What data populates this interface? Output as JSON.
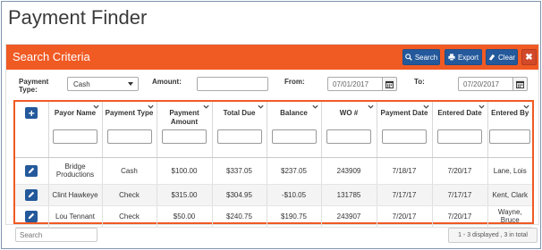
{
  "page": {
    "title": "Payment Finder"
  },
  "panel": {
    "title": "Search Criteria",
    "buttons": {
      "search": "Search",
      "export": "Export",
      "clear": "Clear",
      "close": "✖"
    }
  },
  "criteria": {
    "payment_type_label": "Payment Type:",
    "payment_type_value": "Cash",
    "amount_label": "Amount:",
    "amount_value": "",
    "from_label": "From:",
    "from_value": "07/01/2017",
    "to_label": "To:",
    "to_value": "07/20/2017"
  },
  "table": {
    "columns": [
      "Payor Name",
      "Payment Type",
      "Payment Amount",
      "Total Due",
      "Balance",
      "WO #",
      "Payment Date",
      "Entered Date",
      "Entered By"
    ],
    "rows": [
      [
        "Bridge Productions",
        "Cash",
        "$100.00",
        "$337.05",
        "$237.05",
        "243909",
        "7/18/17",
        "7/20/17",
        "Lane, Lois"
      ],
      [
        "Clint Hawkeye",
        "Check",
        "$315.00",
        "$304.95",
        "-$10.05",
        "131785",
        "7/17/17",
        "7/17/17",
        "Kent, Clark"
      ],
      [
        "Lou Tennant",
        "Check",
        "$50.00",
        "$240.75",
        "$190.75",
        "243907",
        "7/20/17",
        "7/20/17",
        "Wayne, Bruce"
      ]
    ]
  },
  "footer": {
    "search_placeholder": "Search",
    "pager_text": "1 - 3 displayed , 3 in total"
  },
  "colors": {
    "accent": "#f05a23",
    "button": "#24599b"
  }
}
